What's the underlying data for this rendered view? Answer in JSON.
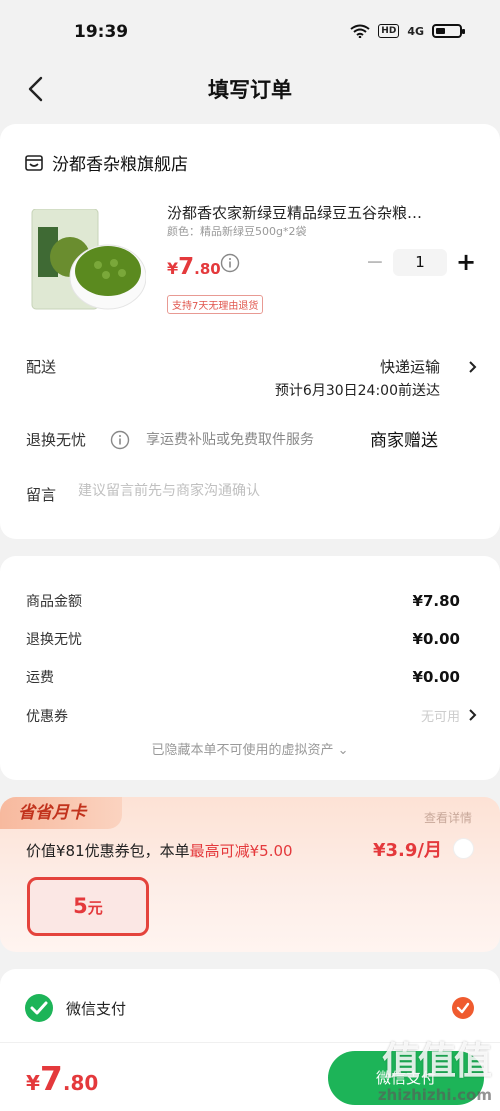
{
  "status_bar": {
    "time": "19:39",
    "hd": "HD",
    "signal": "4G"
  },
  "nav": {
    "title": "填写订单"
  },
  "store": {
    "name": "汾都香杂粮旗舰店"
  },
  "product": {
    "title": "汾都香农家新绿豆精品绿豆五谷杂粮…",
    "spec": "颜色：精品新绿豆500g*2袋",
    "price_symbol": "¥",
    "price_int": "7",
    "price_dec": ".80",
    "quantity": "1",
    "minus": "−",
    "plus": "+",
    "return_badge": "支持7天无理由退货"
  },
  "delivery": {
    "label": "配送",
    "method": "快递运输",
    "eta": "预计6月30日24:00前送达"
  },
  "return_service": {
    "label": "退换无忧",
    "desc": "享运费补贴或免费取件服务",
    "gift": "商家赠送"
  },
  "note": {
    "label": "留言",
    "placeholder": "建议留言前先与商家沟通确认"
  },
  "price_summary": {
    "goods_label": "商品金额",
    "goods_value": "¥7.80",
    "return_label": "退换无忧",
    "return_value": "¥0.00",
    "shipping_label": "运费",
    "shipping_value": "¥0.00",
    "coupon_label": "优惠券",
    "coupon_value": "无可用",
    "hidden_assets": "已隐藏本单不可使用的虚拟资产 ⌄"
  },
  "promo": {
    "badge": "省省月卡",
    "detail_link": "查看详情",
    "desc_prefix": "价值¥81优惠券包，本单",
    "desc_highlight": "最高可减¥5.00",
    "price": "¥3.9/月",
    "coupon_amount": "5",
    "coupon_unit": "元"
  },
  "payment": {
    "method": "微信支付"
  },
  "bottom": {
    "total_symbol": "¥",
    "total_int": "7",
    "total_dec": ".80",
    "pay_button": "微信支付"
  },
  "watermark": {
    "logo": "值值值",
    "text": "zhizhizhi.com"
  },
  "colors": {
    "accent": "#e4393c",
    "wechat_green": "#1db458",
    "check_orange": "#ef5b2f"
  }
}
